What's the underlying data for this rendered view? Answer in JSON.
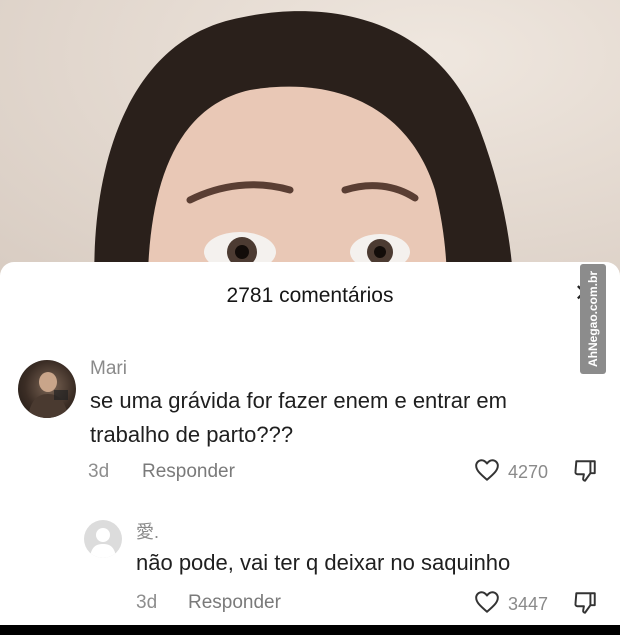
{
  "watermark": "AhNegao.com.br",
  "sheet": {
    "title": "2781 comentários",
    "close": "✕"
  },
  "comments": [
    {
      "username": "Mari",
      "text_line1": "se uma grávida for fazer enem e entrar em",
      "text_line2": "trabalho de parto???",
      "age": "3d",
      "reply_label": "Responder",
      "likes": "4270"
    },
    {
      "username": "愛.",
      "text_line1": "não pode, vai ter q deixar no saquinho",
      "age": "3d",
      "reply_label": "Responder",
      "likes": "3447"
    }
  ],
  "icons": {
    "like": "heart-outline-icon",
    "dislike": "thumbs-down-icon",
    "close": "close-icon"
  },
  "colors": {
    "sheet_bg": "#ffffff",
    "muted_text": "#8a8a8a",
    "body_text": "#1f1f1f"
  }
}
